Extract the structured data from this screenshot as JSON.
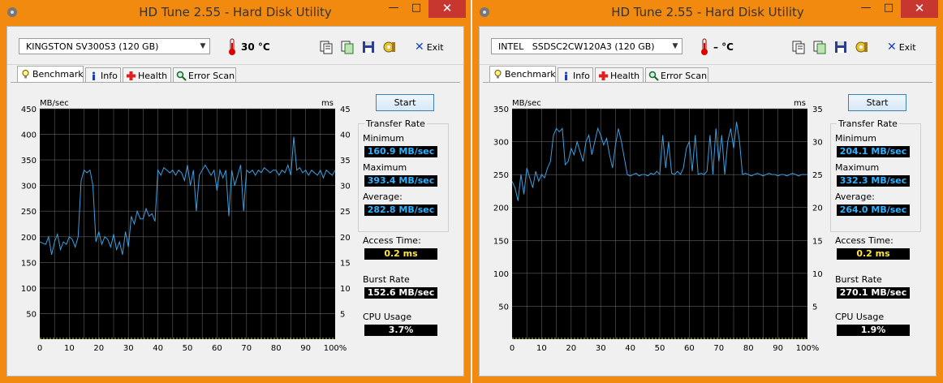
{
  "colors": {
    "titlebar": "#f18a0f",
    "close": "#c7372f",
    "plot_bg": "#000000",
    "grid": "#606060",
    "line": "#3aa0e0",
    "blue_value": "#2fb2ff",
    "yellow_value": "#ffe54a"
  },
  "windows": [
    {
      "title": "HD Tune 2.55 - Hard Disk Utility",
      "controls": {
        "minimize": "—",
        "maximize": "□",
        "close": "✕"
      },
      "drive": "KINGSTON SV300S3 (120 GB)",
      "temperature": "30 °C",
      "exit_label": "Exit",
      "tabs": [
        "Benchmark",
        "Info",
        "Health",
        "Error Scan"
      ],
      "start_label": "Start",
      "transfer_rate_title": "Transfer Rate",
      "minimum_label": "Minimum",
      "minimum_value": "160.9 MB/sec",
      "maximum_label": "Maximum",
      "maximum_value": "393.4 MB/sec",
      "average_label": "Average:",
      "average_value": "282.8 MB/sec",
      "access_label": "Access Time:",
      "access_value": "0.2 ms",
      "burst_label": "Burst Rate",
      "burst_value": "152.6 MB/sec",
      "cpu_label": "CPU Usage",
      "cpu_value": "3.7%"
    },
    {
      "title": "HD Tune 2.55 - Hard Disk Utility",
      "controls": {
        "minimize": "—",
        "maximize": "□",
        "close": "✕"
      },
      "drive": "INTEL   SSDSC2CW120A3 (120 GB)",
      "temperature": "– °C",
      "exit_label": "Exit",
      "tabs": [
        "Benchmark",
        "Info",
        "Health",
        "Error Scan"
      ],
      "start_label": "Start",
      "transfer_rate_title": "Transfer Rate",
      "minimum_label": "Minimum",
      "minimum_value": "204.1 MB/sec",
      "maximum_label": "Maximum",
      "maximum_value": "332.3 MB/sec",
      "average_label": "Average:",
      "average_value": "264.0 MB/sec",
      "access_label": "Access Time:",
      "access_value": "0.2 ms",
      "burst_label": "Burst Rate",
      "burst_value": "270.1 MB/sec",
      "cpu_label": "CPU Usage",
      "cpu_value": "1.9%"
    }
  ],
  "chart_data": [
    {
      "type": "line",
      "ylabel": "MB/sec",
      "y2label": "ms",
      "ylim": [
        0,
        450
      ],
      "y2lim": [
        0,
        45
      ],
      "yticks": [
        50,
        100,
        150,
        200,
        250,
        300,
        350,
        400,
        450
      ],
      "y2ticks": [
        5,
        10,
        15,
        20,
        25,
        30,
        35,
        40,
        45
      ],
      "xticks": [
        "0",
        "10",
        "20",
        "30",
        "40",
        "50",
        "60",
        "70",
        "80",
        "90",
        "100%"
      ],
      "grid": true,
      "series": [
        {
          "x": [
            0,
            2,
            3,
            4,
            5,
            6,
            7,
            8,
            9,
            10,
            11,
            12,
            13,
            14,
            15,
            16,
            17,
            18,
            19,
            20,
            21,
            22,
            23,
            24,
            25,
            26,
            27,
            28,
            29,
            30,
            31,
            32,
            33,
            34,
            35,
            36,
            37,
            38,
            39,
            40,
            41,
            42,
            43,
            44,
            45,
            46,
            47,
            48,
            49,
            50,
            51,
            52,
            53,
            54,
            55,
            56,
            57,
            58,
            59,
            60,
            61,
            62,
            63,
            64,
            65,
            66,
            67,
            68,
            69,
            70,
            71,
            72,
            73,
            74,
            75,
            76,
            77,
            78,
            79,
            80,
            81,
            82,
            83,
            84,
            85,
            86,
            87,
            88,
            89,
            90,
            91,
            92,
            93,
            94,
            95,
            96,
            97,
            98,
            99,
            100
          ],
          "y": [
            190,
            185,
            200,
            165,
            190,
            205,
            175,
            190,
            185,
            200,
            195,
            180,
            200,
            310,
            330,
            325,
            330,
            300,
            190,
            210,
            185,
            200,
            195,
            180,
            205,
            175,
            190,
            165,
            210,
            180,
            240,
            225,
            250,
            235,
            235,
            255,
            240,
            245,
            230,
            330,
            320,
            335,
            330,
            325,
            330,
            320,
            330,
            325,
            310,
            340,
            300,
            330,
            250,
            320,
            330,
            340,
            330,
            320,
            330,
            290,
            330,
            315,
            330,
            240,
            330,
            300,
            320,
            340,
            250,
            330,
            325,
            330,
            320,
            330,
            325,
            335,
            330,
            325,
            330,
            330,
            320,
            330,
            325,
            340,
            320,
            395,
            330,
            335,
            325,
            330,
            320,
            330,
            325,
            320,
            330,
            315,
            330,
            325,
            320,
            330
          ]
        }
      ]
    },
    {
      "type": "line",
      "ylabel": "MB/sec",
      "y2label": "ms",
      "ylim": [
        0,
        350
      ],
      "y2lim": [
        0,
        35
      ],
      "yticks": [
        50,
        100,
        150,
        200,
        250,
        300,
        350
      ],
      "y2ticks": [
        5,
        10,
        15,
        20,
        25,
        30,
        35
      ],
      "xticks": [
        "0",
        "10",
        "20",
        "30",
        "40",
        "50",
        "60",
        "70",
        "80",
        "90",
        "100%"
      ],
      "grid": true,
      "series": [
        {
          "x": [
            0,
            1,
            2,
            3,
            4,
            5,
            6,
            7,
            8,
            9,
            10,
            11,
            12,
            13,
            14,
            15,
            16,
            17,
            18,
            19,
            20,
            21,
            22,
            23,
            24,
            25,
            26,
            27,
            28,
            29,
            30,
            31,
            32,
            33,
            34,
            35,
            36,
            37,
            38,
            39,
            40,
            41,
            42,
            43,
            44,
            45,
            46,
            47,
            48,
            49,
            50,
            51,
            52,
            53,
            54,
            55,
            56,
            57,
            58,
            59,
            60,
            61,
            62,
            63,
            64,
            65,
            66,
            67,
            68,
            69,
            70,
            71,
            72,
            73,
            74,
            75,
            76,
            77,
            78,
            79,
            80,
            81,
            82,
            83,
            84,
            85,
            86,
            87,
            88,
            89,
            90,
            91,
            92,
            93,
            94,
            95,
            96,
            97,
            98,
            99,
            100
          ],
          "y": [
            240,
            230,
            210,
            250,
            220,
            260,
            245,
            230,
            255,
            240,
            250,
            245,
            260,
            270,
            310,
            320,
            315,
            320,
            265,
            270,
            290,
            280,
            300,
            285,
            270,
            300,
            310,
            280,
            300,
            320,
            310,
            295,
            305,
            280,
            260,
            295,
            320,
            300,
            275,
            250,
            248,
            250,
            252,
            248,
            250,
            250,
            248,
            252,
            250,
            255,
            250,
            310,
            260,
            300,
            252,
            250,
            255,
            250,
            260,
            290,
            300,
            255,
            310,
            250,
            252,
            250,
            255,
            310,
            250,
            320,
            270,
            310,
            250,
            300,
            320,
            290,
            330,
            300,
            250,
            252,
            250,
            248,
            250,
            252,
            250,
            248,
            250,
            252,
            250,
            250,
            248,
            250,
            250,
            248,
            250,
            252,
            250,
            248,
            250,
            250,
            250
          ]
        }
      ]
    }
  ]
}
